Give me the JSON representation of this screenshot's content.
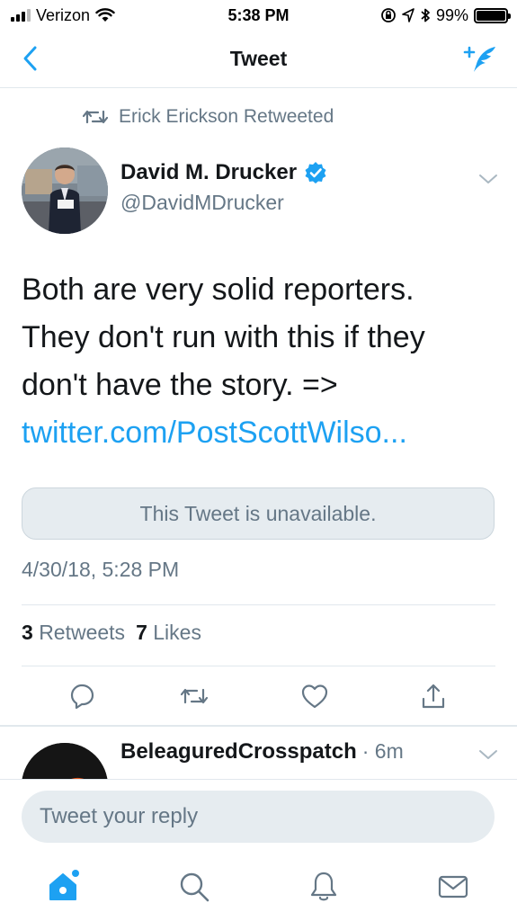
{
  "status_bar": {
    "carrier": "Verizon",
    "time": "5:38 PM",
    "battery": "99%",
    "battery_level": 0.99
  },
  "nav": {
    "title": "Tweet",
    "back_icon": "chevron-left-icon",
    "compose_icon": "compose-tweet-icon"
  },
  "tweet": {
    "retweeted_by": "Erick Erickson Retweeted",
    "author_name": "David M. Drucker",
    "author_handle": "@DavidMDrucker",
    "verified": true,
    "text_lines": [
      "Both are very solid reporters.",
      "They don't run with this if they",
      "don't have the story. =>"
    ],
    "link": "twitter.com/PostScottWilso...",
    "quoted_tweet": "This Tweet is unavailable.",
    "timestamp": "4/30/18, 5:28 PM",
    "retweets_count": "3",
    "retweets_label": "Retweets",
    "likes_count": "7",
    "likes_label": "Likes"
  },
  "reply_preview": {
    "name": "BeleaguredCrosspatch",
    "time": "· 6m"
  },
  "reply_bar": {
    "placeholder": "Tweet your reply"
  },
  "colors": {
    "accent": "#1da1f2",
    "secondary_text": "#657786",
    "divider": "#e1e8ed"
  }
}
